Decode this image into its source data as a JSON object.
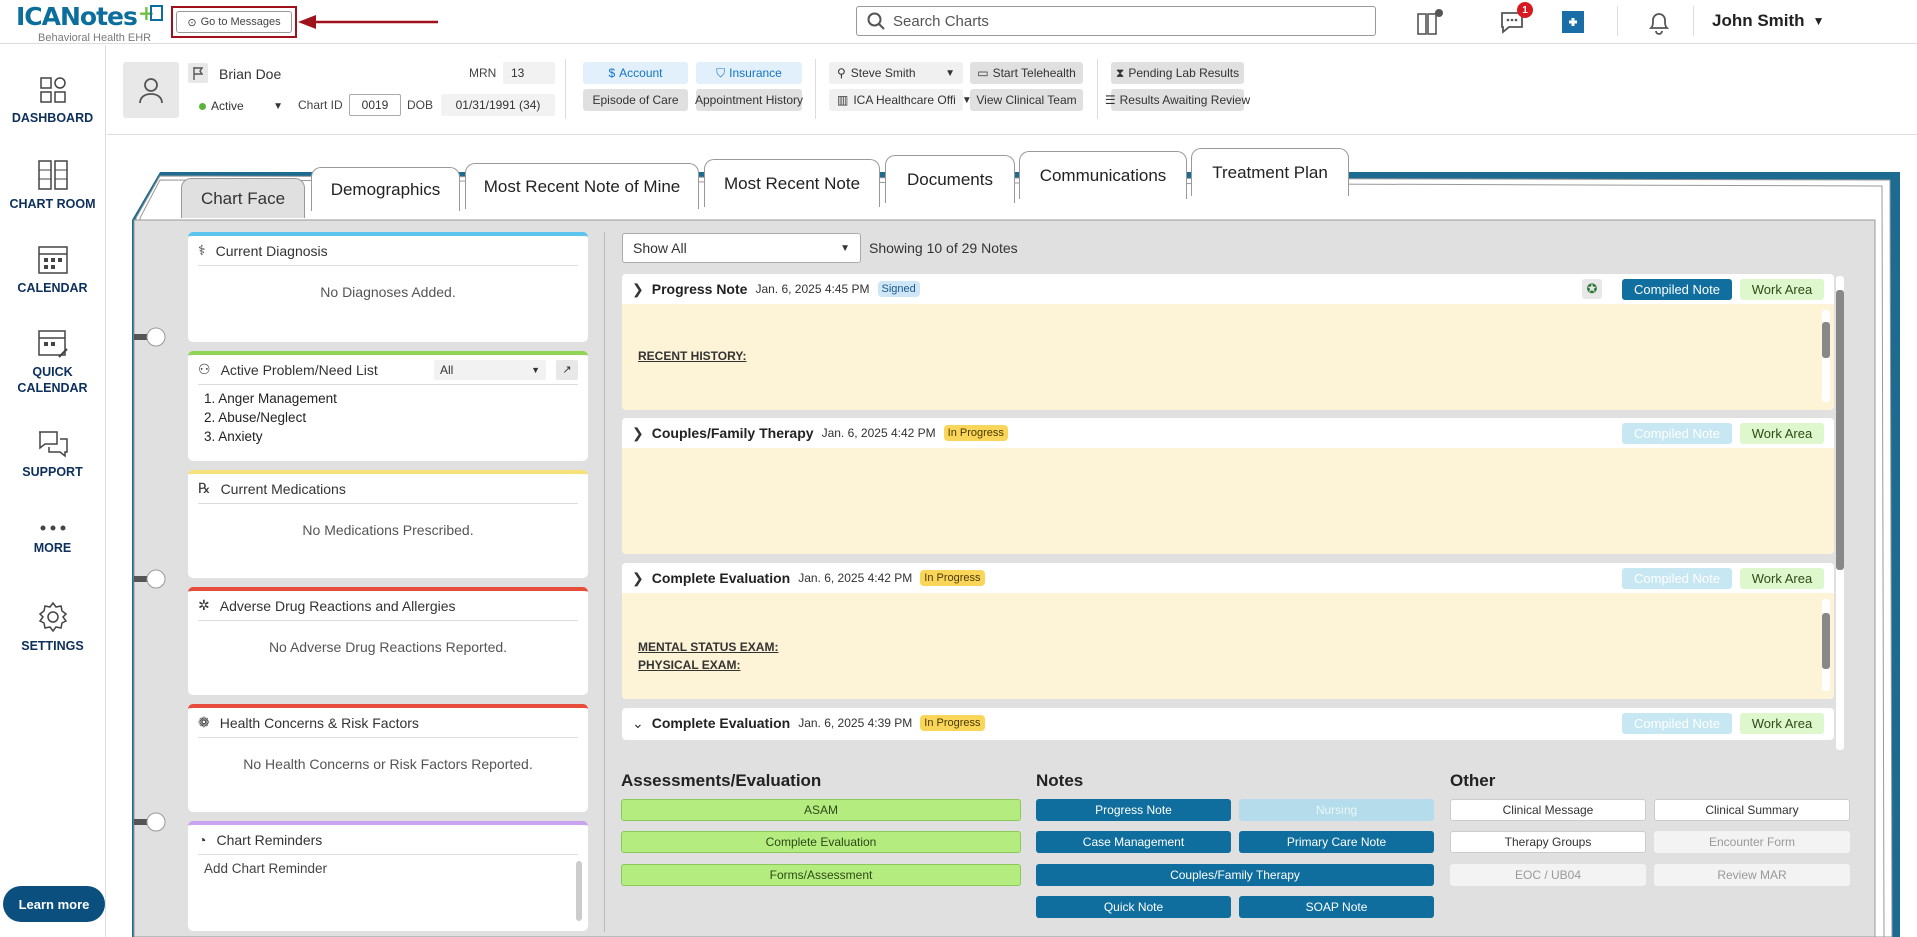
{
  "app": {
    "brand_a": "ICA",
    "brand_b": "Notes",
    "tagline": "Behavioral Health EHR",
    "goto_messages": "Go to Messages",
    "search_placeholder": "Search Charts",
    "message_count": "1",
    "user_name": "John Smith"
  },
  "sidebar": {
    "items": [
      {
        "label": "DASHBOARD",
        "icon": "dashboard-icon"
      },
      {
        "label": "CHART ROOM",
        "icon": "chart-room-icon"
      },
      {
        "label": "CALENDAR",
        "icon": "calendar-icon"
      },
      {
        "label": "QUICK",
        "label2": "CALENDAR",
        "icon": "quick-calendar-icon"
      },
      {
        "label": "SUPPORT",
        "icon": "support-icon"
      },
      {
        "label": "MORE",
        "icon": "more-icon"
      },
      {
        "label": "SETTINGS",
        "icon": "gear-icon"
      }
    ],
    "learn_more": "Learn more"
  },
  "patient": {
    "name": "Brian Doe",
    "status": "Active",
    "chart_id_label": "Chart ID",
    "chart_id": "0019",
    "mrn_label": "MRN",
    "mrn": "13",
    "dob_label": "DOB",
    "dob": "01/31/1991 (34)"
  },
  "header_buttons": {
    "account": "Account",
    "insurance": "Insurance",
    "episode": "Episode of Care",
    "appointment": "Appointment History",
    "provider": "Steve Smith",
    "location": "ICA Healthcare Offi",
    "telehealth": "Start Telehealth",
    "clinical_team": "View Clinical Team",
    "pending_lab": "Pending Lab Results",
    "results_review": "Results Awaiting Review"
  },
  "tabs": [
    "Chart Face",
    "Demographics",
    "Most Recent Note of Mine",
    "Most Recent Note",
    "Documents",
    "Communications",
    "Treatment Plan"
  ],
  "panels": {
    "diagnosis": {
      "title": "Current Diagnosis",
      "empty": "No Diagnoses Added.",
      "color": "#5bc4ef"
    },
    "problems": {
      "title": "Active Problem/Need List",
      "filter": "All",
      "items": [
        "1. Anger Management",
        "2. Abuse/Neglect",
        "3. Anxiety"
      ],
      "color": "#8fd455"
    },
    "medications": {
      "title": "Current Medications",
      "empty": "No Medications Prescribed.",
      "color": "#f6e27a"
    },
    "adverse": {
      "title": "Adverse Drug Reactions and Allergies",
      "empty": "No Adverse Drug Reactions Reported.",
      "color": "#e74c3c"
    },
    "health": {
      "title": "Health Concerns & Risk Factors",
      "empty": "No Health Concerns or Risk Factors Reported.",
      "color": "#e74c3c"
    },
    "reminders": {
      "title": "Chart Reminders",
      "add": "Add Chart Reminder",
      "color": "#c9a2f0"
    }
  },
  "notes_filter": {
    "selected": "Show All",
    "showing": "Showing 10 of 29 Notes"
  },
  "notes": [
    {
      "title": "Progress Note",
      "date": "Jan. 6, 2025 4:45 PM",
      "status": "Signed",
      "body": [
        "RECENT HISTORY:"
      ]
    },
    {
      "title": "Couples/Family Therapy",
      "date": "Jan. 6, 2025 4:42 PM",
      "status": "In Progress",
      "body": []
    },
    {
      "title": "Complete Evaluation",
      "date": "Jan. 6, 2025 4:42 PM",
      "status": "In Progress",
      "body": [
        "MENTAL STATUS EXAM:",
        "PHYSICAL EXAM:"
      ]
    },
    {
      "title": "Complete Evaluation",
      "date": "Jan. 6, 2025 4:39 PM",
      "status": "In Progress",
      "body": []
    }
  ],
  "note_actions": {
    "compiled": "Compiled Note",
    "work_area": "Work Area"
  },
  "sections": {
    "assess_title": "Assessments/Evaluation",
    "assess": [
      "ASAM",
      "Complete Evaluation",
      "Forms/Assessment"
    ],
    "notes_title": "Notes",
    "notes": [
      "Progress Note",
      "Nursing",
      "Case Management",
      "Primary Care Note",
      "Couples/Family Therapy",
      "Quick Note",
      "SOAP Note"
    ],
    "other_title": "Other",
    "other": [
      "Clinical Message",
      "Clinical Summary",
      "Therapy Groups",
      "Encounter Form",
      "EOC / UB04",
      "Review MAR"
    ]
  }
}
